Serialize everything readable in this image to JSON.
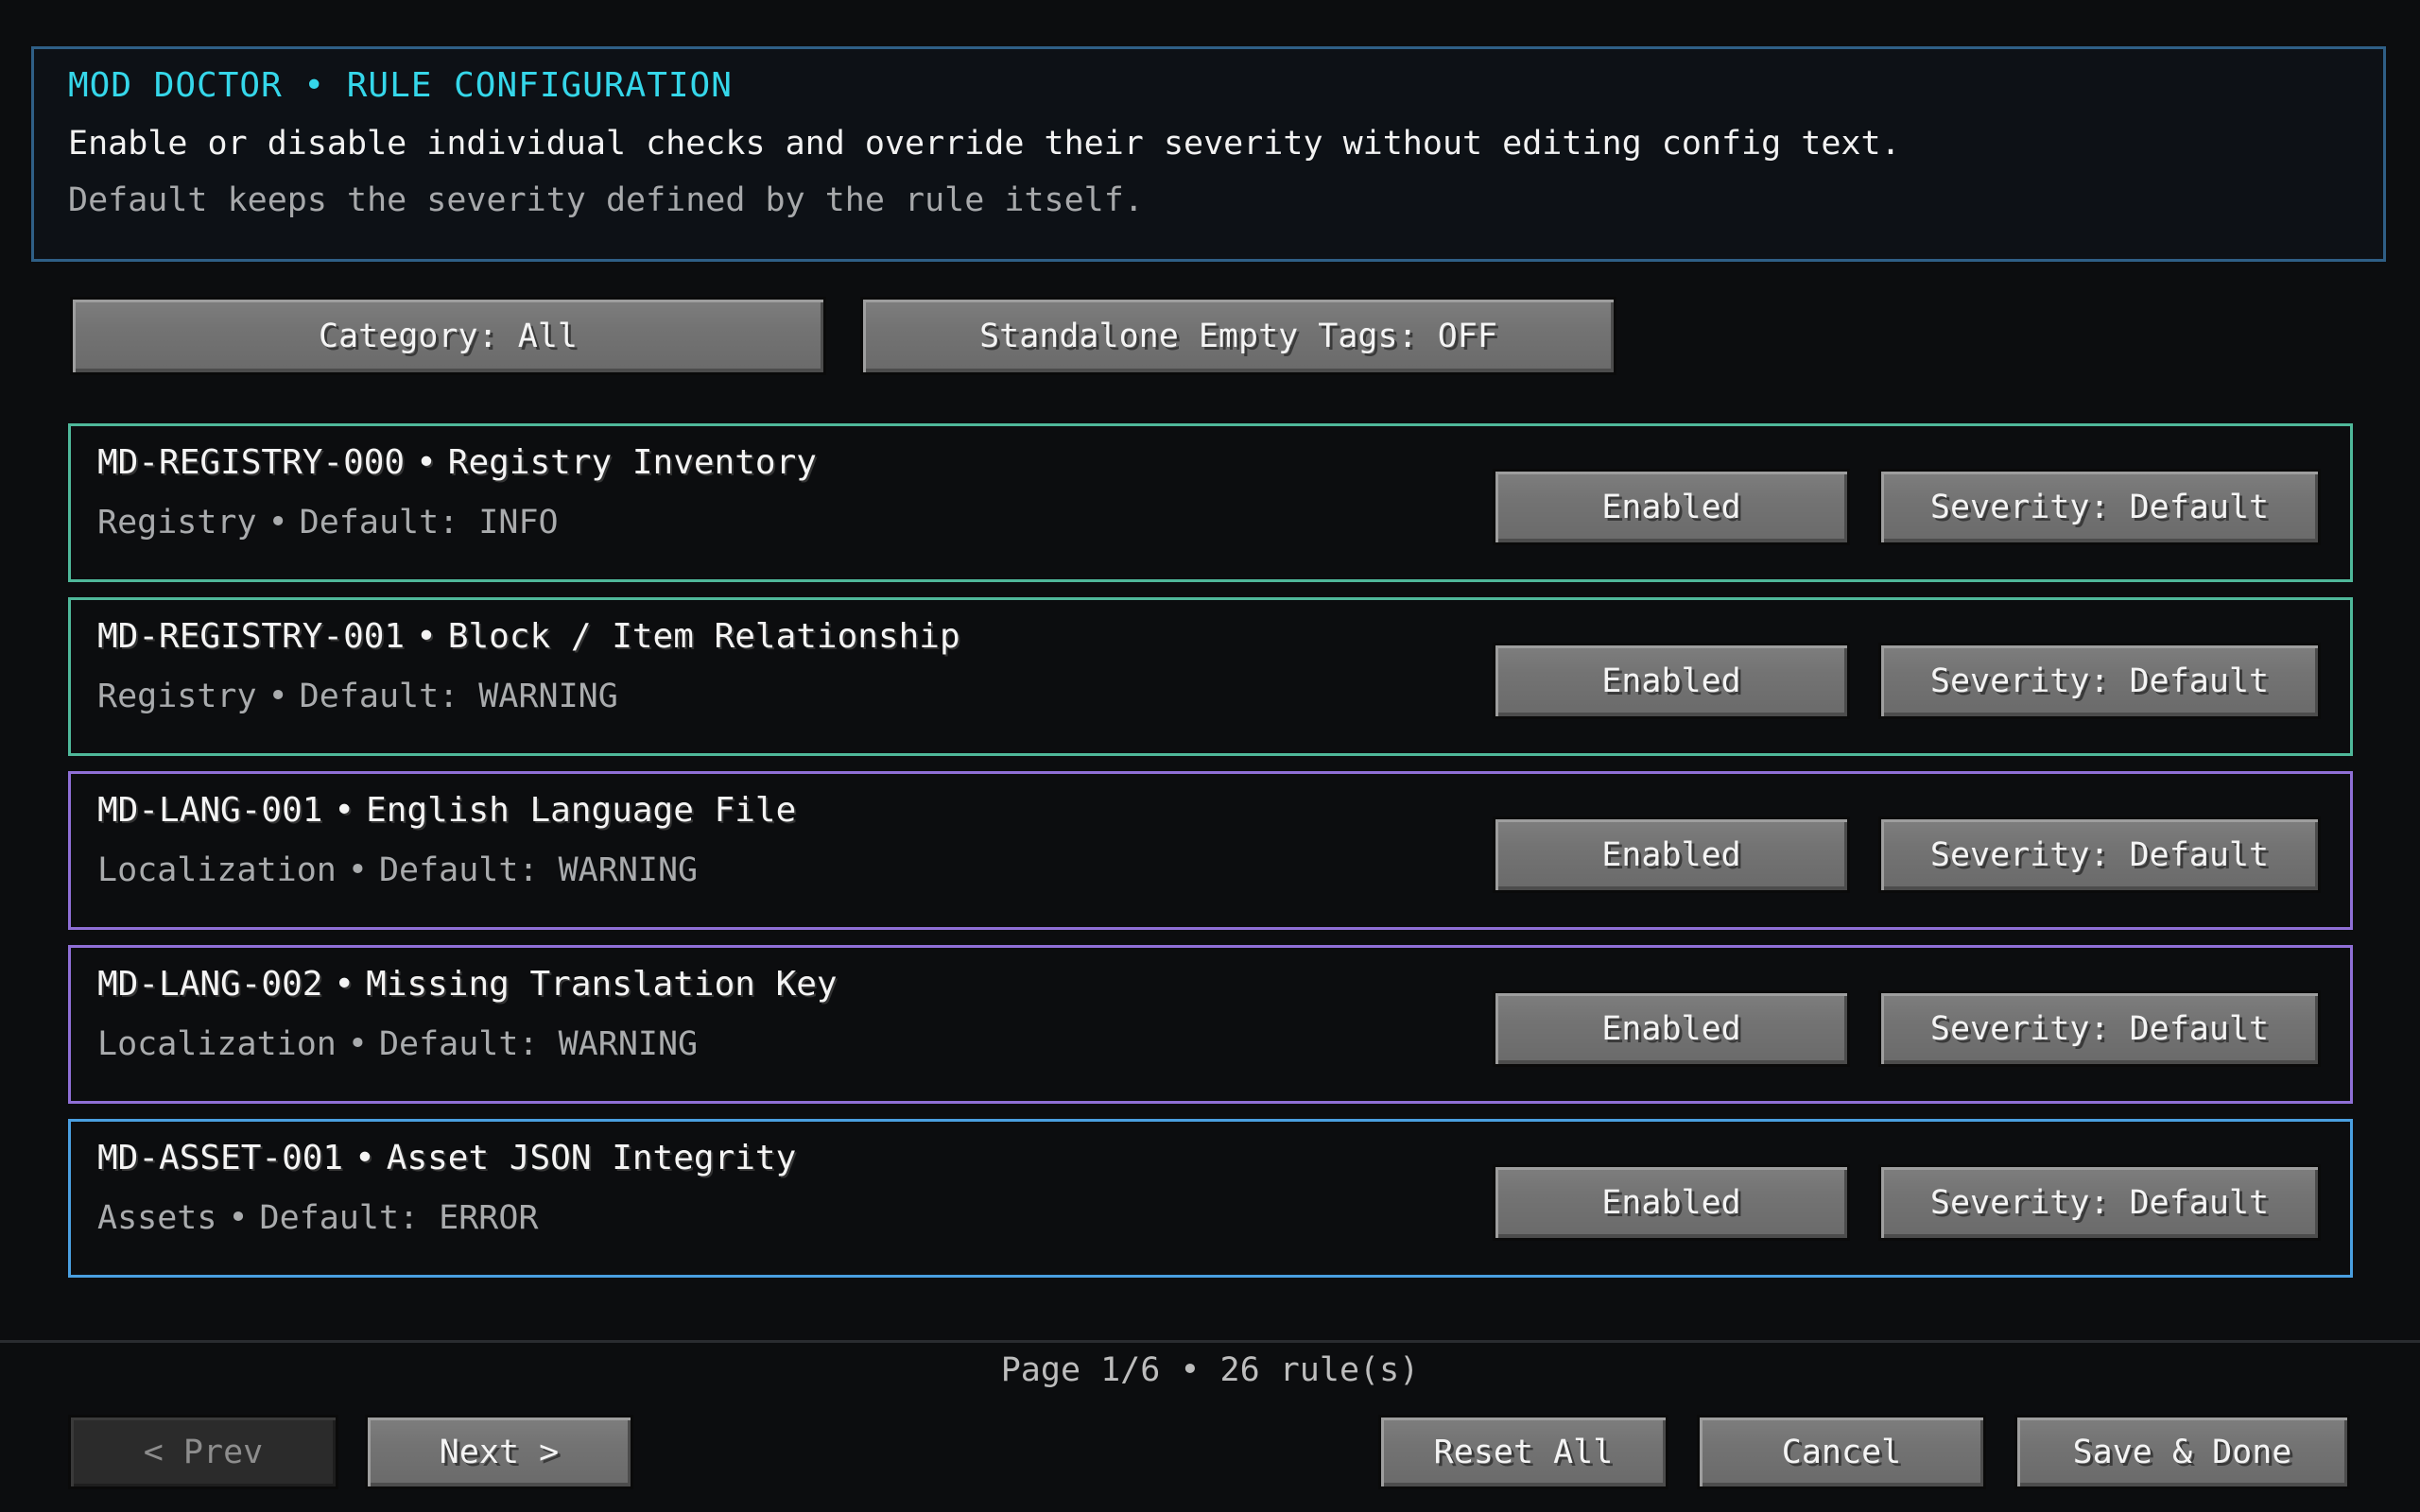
{
  "header": {
    "title": "MOD DOCTOR • RULE CONFIGURATION",
    "description": "Enable or disable individual checks and override their severity without editing config text.",
    "note": "Default keeps the severity defined by the rule itself."
  },
  "filters": {
    "category_label": "Category: All",
    "empty_tags_label": "Standalone Empty Tags: OFF"
  },
  "rules": [
    {
      "id": "MD-REGISTRY-000",
      "name": "Registry Inventory",
      "category": "Registry",
      "default": "Default: INFO",
      "enabled_label": "Enabled",
      "severity_label": "Severity: Default",
      "border_color": "#4fb89a"
    },
    {
      "id": "MD-REGISTRY-001",
      "name": "Block / Item Relationship",
      "category": "Registry",
      "default": "Default: WARNING",
      "enabled_label": "Enabled",
      "severity_label": "Severity: Default",
      "border_color": "#4fb89a"
    },
    {
      "id": "MD-LANG-001",
      "name": "English Language File",
      "category": "Localization",
      "default": "Default: WARNING",
      "enabled_label": "Enabled",
      "severity_label": "Severity: Default",
      "border_color": "#8f6fd6"
    },
    {
      "id": "MD-LANG-002",
      "name": "Missing Translation Key",
      "category": "Localization",
      "default": "Default: WARNING",
      "enabled_label": "Enabled",
      "severity_label": "Severity: Default",
      "border_color": "#8f6fd6"
    },
    {
      "id": "MD-ASSET-001",
      "name": "Asset JSON Integrity",
      "category": "Assets",
      "default": "Default: ERROR",
      "enabled_label": "Enabled",
      "severity_label": "Severity: Default",
      "border_color": "#4a9fe0"
    }
  ],
  "separator": "•",
  "footer": {
    "status": "Page 1/6  •  26 rule(s)",
    "prev_label": "< Prev",
    "next_label": "Next >",
    "reset_label": "Reset All",
    "cancel_label": "Cancel",
    "save_label": "Save & Done"
  },
  "colors": {
    "accent_title": "#35d7ea",
    "header_border": "#2f5f86",
    "registry_border": "#4fb89a",
    "localization_border": "#8f6fd6",
    "assets_border": "#4a9fe0"
  }
}
